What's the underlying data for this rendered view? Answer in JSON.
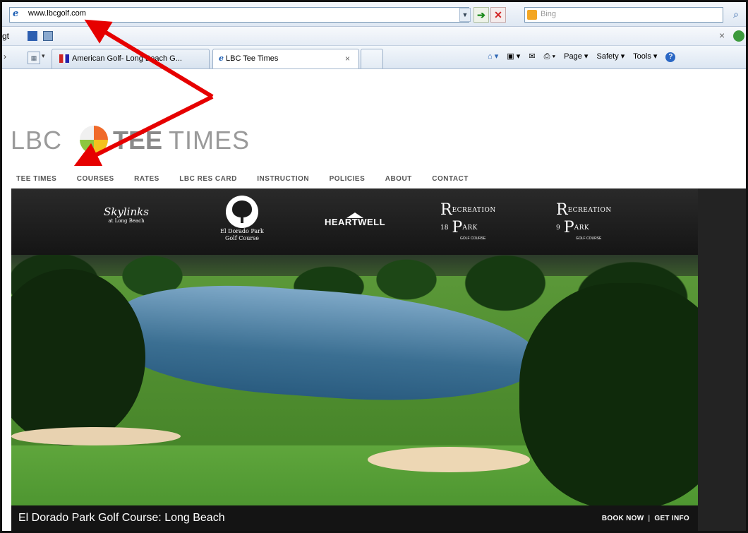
{
  "browser": {
    "url": "www.lbcgolf.com",
    "search_placeholder": "Bing",
    "links_bar_label": "gt",
    "tabs": [
      {
        "label": "American Golf- Long Beach G..."
      },
      {
        "label": "LBC Tee Times"
      }
    ],
    "command_bar": {
      "page": "Page ▾",
      "safety": "Safety ▾",
      "tools": "Tools ▾"
    }
  },
  "site": {
    "logo": {
      "left": "LBC",
      "bold": "TEE",
      "right": "TIMES"
    },
    "nav": [
      "TEE TIMES",
      "COURSES",
      "RATES",
      "LBC RES CARD",
      "INSTRUCTION",
      "POLICIES",
      "ABOUT",
      "CONTACT"
    ],
    "courses": {
      "skylinks": {
        "name": "Skylinks",
        "sub": "at Long Beach"
      },
      "eldorado": {
        "line1": "El Dorado Park",
        "line2": "Golf Course"
      },
      "heartwell": {
        "name": "HEARTWELL"
      },
      "rec18": {
        "big": "R",
        "word1": "ECREATION",
        "num": "18",
        "big2": "P",
        "word2": "ARK",
        "gc": "GOLF COURSE"
      },
      "rec9": {
        "big": "R",
        "word1": "ECREATION",
        "num": "9",
        "big2": "P",
        "word2": "ARK",
        "gc": "GOLF COURSE"
      }
    },
    "caption": "El Dorado Park Golf Course: Long Beach",
    "book_now": "BOOK NOW",
    "get_info": "GET INFO"
  }
}
